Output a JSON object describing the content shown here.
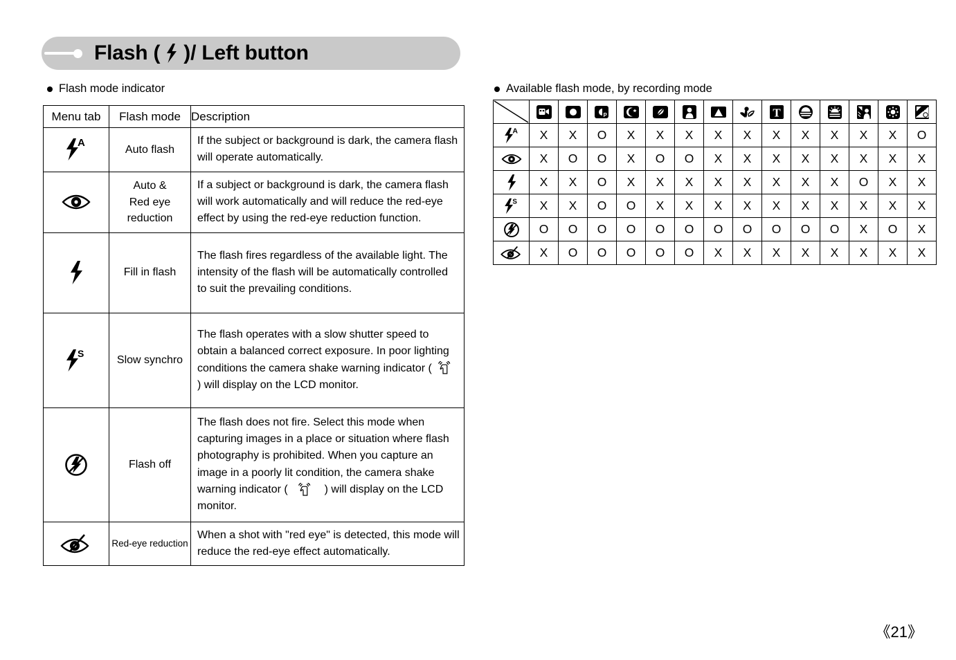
{
  "header": {
    "title_before": "Flash (",
    "icon": "flash-bolt-icon",
    "title_after": ")/ Left button"
  },
  "left_section": {
    "caption": "Flash mode indicator",
    "table": {
      "headers": [
        "Menu tab",
        "Flash mode",
        "Description"
      ],
      "rows": [
        {
          "icon": "flash-auto-icon",
          "mode": "Auto flash",
          "description": "If the subject or background is dark, the camera flash will operate automatically."
        },
        {
          "icon": "red-eye-icon",
          "mode": "Auto &\nRed eye\nreduction",
          "description": "If a subject or background is dark, the camera flash will work automatically and will reduce the red-eye effect by using the red-eye reduction function."
        },
        {
          "icon": "fill-flash-icon",
          "mode": "Fill in flash",
          "description": "The flash fires regardless of the available light. The intensity of the flash will be automatically controlled to suit the prevailing conditions."
        },
        {
          "icon": "slow-synchro-icon",
          "mode": "Slow synchro",
          "description_part1": "The flash operates with a slow shutter speed to obtain a balanced correct exposure. In poor lighting conditions the camera shake warning indicator (",
          "description_inline_icon": "camera-shake-icon",
          "description_part2": ") will display on the LCD monitor."
        },
        {
          "icon": "flash-off-icon",
          "mode": "Flash off",
          "description_part1": "The flash does not fire. Select this mode when capturing images in a place or situation where flash photography is prohibited. When you capture an image in a poorly lit condition, the camera shake warning indicator (",
          "description_inline_icon": "camera-shake-icon",
          "description_part2": ") will display on the LCD monitor."
        },
        {
          "icon": "red-eye-reduction-icon",
          "mode": "Red-eye reduction",
          "description": "When a shot with \"red eye\" is detected, this mode will reduce the red-eye effect automatically."
        }
      ]
    }
  },
  "right_section": {
    "caption": "Available flash mode, by recording mode",
    "matrix": {
      "column_icons": [
        "movie-clip-icon",
        "auto-mode-icon",
        "program-mode-icon",
        "night-mode-icon",
        "portrait-scene-icon",
        "portrait-mode-icon",
        "landscape-mode-icon",
        "close-up-mode-icon",
        "text-mode-icon",
        "sunset-mode-icon",
        "dawn-mode-icon",
        "backlight-mode-icon",
        "fireworks-mode-icon",
        "beach-snow-mode-icon"
      ],
      "row_icons": [
        "flash-auto-icon",
        "red-eye-icon",
        "fill-flash-icon",
        "slow-synchro-icon",
        "flash-off-icon",
        "red-eye-reduction-icon"
      ],
      "values": [
        [
          "X",
          "X",
          "O",
          "X",
          "X",
          "X",
          "X",
          "X",
          "X",
          "X",
          "X",
          "X",
          "X",
          "O"
        ],
        [
          "X",
          "O",
          "O",
          "X",
          "O",
          "O",
          "X",
          "X",
          "X",
          "X",
          "X",
          "X",
          "X",
          "X"
        ],
        [
          "X",
          "X",
          "O",
          "X",
          "X",
          "X",
          "X",
          "X",
          "X",
          "X",
          "X",
          "O",
          "X",
          "X"
        ],
        [
          "X",
          "X",
          "O",
          "O",
          "X",
          "X",
          "X",
          "X",
          "X",
          "X",
          "X",
          "X",
          "X",
          "X"
        ],
        [
          "O",
          "O",
          "O",
          "O",
          "O",
          "O",
          "O",
          "O",
          "O",
          "O",
          "O",
          "X",
          "O",
          "X"
        ],
        [
          "X",
          "O",
          "O",
          "O",
          "O",
          "O",
          "X",
          "X",
          "X",
          "X",
          "X",
          "X",
          "X",
          "X"
        ]
      ]
    }
  },
  "footer": {
    "page_number": "《21》"
  }
}
